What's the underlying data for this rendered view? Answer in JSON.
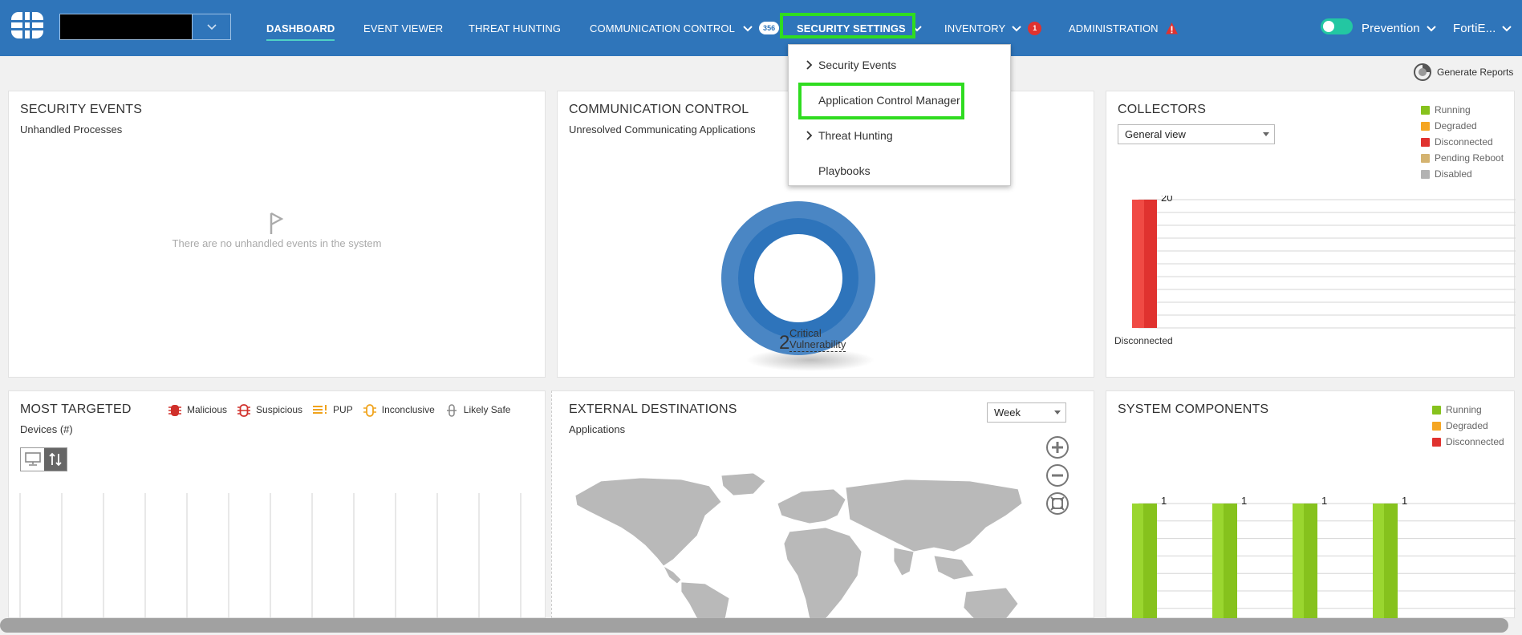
{
  "nav": {
    "items": [
      {
        "label": "DASHBOARD",
        "active": true
      },
      {
        "label": "EVENT VIEWER"
      },
      {
        "label": "THREAT HUNTING"
      },
      {
        "label": "COMMUNICATION CONTROL",
        "badge": "356"
      },
      {
        "label": "SECURITY SETTINGS"
      },
      {
        "label": "INVENTORY",
        "badge": "1"
      },
      {
        "label": "ADMINISTRATION"
      }
    ],
    "mode_label": "Prevention",
    "user_label": "FortiE...",
    "accent_color": "#2f75ba",
    "highlight_color": "#2fdc20"
  },
  "security_menu": {
    "items": [
      "Security Events",
      "Application Control Manager",
      "Threat Hunting",
      "Playbooks"
    ]
  },
  "toolbar": {
    "generate_reports": "Generate Reports"
  },
  "security_events": {
    "title": "SECURITY EVENTS",
    "subtitle": "Unhandled Processes",
    "empty_message": "There are no unhandled events in the system"
  },
  "communication_control": {
    "title": "COMMUNICATION CONTROL",
    "subtitle": "Unresolved Communicating Applications",
    "count": "2",
    "count_label_line1": "Critical",
    "count_label_line2": "Vulnerability"
  },
  "collectors": {
    "title": "COLLECTORS",
    "view_select": "General view",
    "legend": [
      {
        "label": "Running",
        "color": "#86c21d"
      },
      {
        "label": "Degraded",
        "color": "#f5a623"
      },
      {
        "label": "Disconnected",
        "color": "#e0322f"
      },
      {
        "label": "Pending Reboot",
        "color": "#d4b370"
      },
      {
        "label": "Disabled",
        "color": "#b3b3b3"
      }
    ],
    "chart_data": {
      "type": "bar",
      "categories": [
        "Disconnected"
      ],
      "values": [
        20
      ]
    }
  },
  "most_targeted": {
    "title": "MOST TARGETED",
    "subtitle": "Devices (#)",
    "legend": [
      {
        "label": "Malicious",
        "color": "#d0302b"
      },
      {
        "label": "Suspicious",
        "color": "#d0302b"
      },
      {
        "label": "PUP",
        "color": "#f0a31c"
      },
      {
        "label": "Inconclusive",
        "color": "#f0a31c"
      },
      {
        "label": "Likely Safe",
        "color": "#888888"
      }
    ]
  },
  "external_destinations": {
    "title": "EXTERNAL DESTINATIONS",
    "subtitle": "Applications",
    "period_select": "Week"
  },
  "system_components": {
    "title": "SYSTEM COMPONENTS",
    "legend": [
      {
        "label": "Running",
        "color": "#86c21d"
      },
      {
        "label": "Degraded",
        "color": "#f5a623"
      },
      {
        "label": "Disconnected",
        "color": "#e0322f"
      }
    ],
    "chart_data": {
      "type": "bar",
      "values": [
        1,
        1,
        1,
        1
      ]
    }
  }
}
